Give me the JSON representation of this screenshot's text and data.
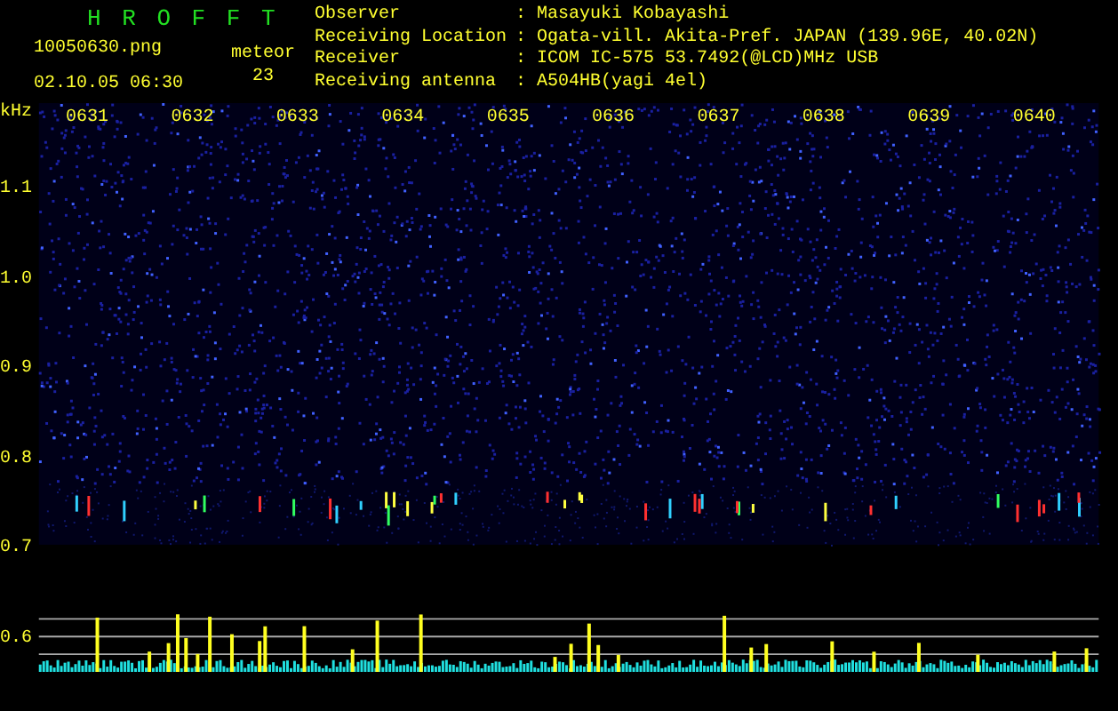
{
  "app_title": "H R O F F T",
  "file_name": "10050630.png",
  "timestamp": "02.10.05 06:30",
  "meteor": {
    "label": "meteor",
    "count": "23"
  },
  "station": [
    {
      "label": "Observer",
      "separator": ":",
      "value": "Masayuki Kobayashi"
    },
    {
      "label": "Receiving Location",
      "separator": ":",
      "value": "Ogata-vill. Akita-Pref. JAPAN (139.96E, 40.02N)"
    },
    {
      "label": "Receiver",
      "separator": ":",
      "value": "ICOM IC-575 53.7492(@LCD)MHz USB"
    },
    {
      "label": "Receiving antenna",
      "separator": ":",
      "value": "A504HB(yagi 4el)"
    }
  ],
  "y_axis": {
    "unit": "kHz",
    "ticks": [
      "1.1",
      "1.0",
      "0.9",
      "0.8",
      "0.7",
      "0.6"
    ]
  },
  "time_labels": [
    "0631",
    "0632",
    "0633",
    "0634",
    "0635",
    "0636",
    "0637",
    "0638",
    "0639",
    "0640"
  ]
}
